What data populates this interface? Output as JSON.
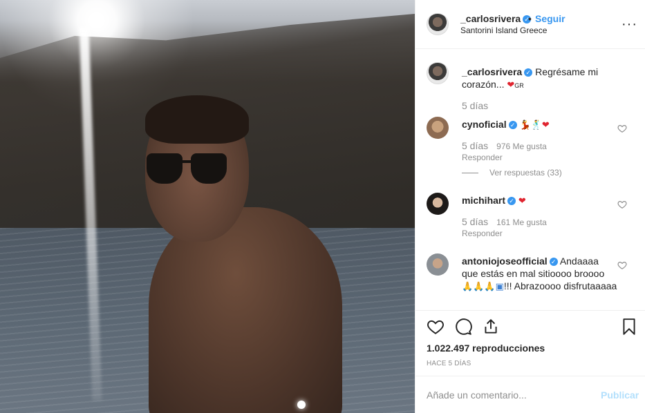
{
  "header": {
    "username": "_carlosrivera",
    "separator": "•",
    "follow_label": "Seguir",
    "location": "Santorini Island Greece",
    "more_icon": "more-options-icon"
  },
  "caption": {
    "username": "_carlosrivera",
    "text": "Regrésame mi corazón...",
    "suffix": "GR",
    "time": "5 días"
  },
  "comments": [
    {
      "username": "cynoficial",
      "emoji": "💃🕺",
      "time": "5 días",
      "likes": "976 Me gusta",
      "reply_label": "Responder",
      "view_replies": "Ver respuestas (33)"
    },
    {
      "username": "michihart",
      "time": "5 días",
      "likes": "161 Me gusta",
      "reply_label": "Responder"
    },
    {
      "username": "antoniojoseofficial",
      "text": "Andaaaa que estás en mal sitioooo broooo",
      "text2": "!!! Abrazoooo disfrutaaaaa"
    }
  ],
  "footer": {
    "views": "1.022.497 reproducciones",
    "posted": "HACE 5 DÍAS",
    "comment_placeholder": "Añade un comentario...",
    "publish_label": "Publicar"
  },
  "colors": {
    "link_blue": "#3897f0",
    "publish_disabled": "#b2dffc",
    "muted_gray": "#8e8e8e"
  }
}
